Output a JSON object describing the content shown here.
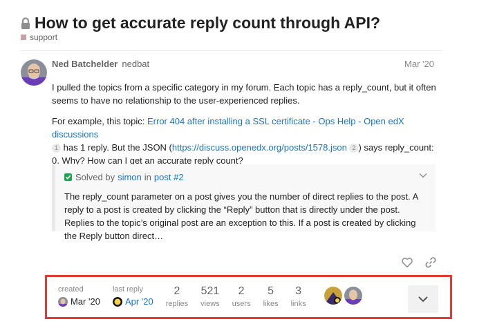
{
  "topic": {
    "title": "How to get accurate reply count through API?",
    "category": "support",
    "category_color": "#c7a1a9"
  },
  "post": {
    "author_name": "Ned Batchelder",
    "author_username": "nedbat",
    "date": "Mar '20",
    "paragraph1": "I pulled the topics from a specific category in my forum. Each topic has a reply_count, but it often seems to have no relationship to the user-experienced replies.",
    "p2_prefix": "For example, this topic: ",
    "p2_link1": "Error 404 after installing a SSL certificate - Ops Help - Open edX discussions",
    "p2_badge1": "1",
    "p2_mid": " has 1 reply. But the JSON (",
    "p2_link2": "https://discuss.openedx.org/posts/1578.json",
    "p2_badge2": "2",
    "p2_suffix": ") says reply_count: 0. Why? How can I get an accurate reply count?"
  },
  "solution": {
    "solved_by_label": "Solved by",
    "solver": "simon",
    "in_label": "in",
    "post_ref": "post #2",
    "excerpt": "The reply_count parameter on a post gives you the number of direct replies to the post. A reply to a post is created by clicking the “Reply” button that is directly under the post. Replies to the topic’s original post are an exception to this. If a post is created by clicking the Reply button direct…",
    "check_color": "#1ca551"
  },
  "actions": {
    "like_icon": "heart-icon",
    "share_icon": "link-icon"
  },
  "summary": {
    "created_label": "created",
    "created_date": "Mar '20",
    "last_reply_label": "last reply",
    "last_reply_date": "Apr '20",
    "replies_count": "2",
    "replies_label": "replies",
    "views_count": "521",
    "views_label": "views",
    "users_count": "2",
    "users_label": "users",
    "likes_count": "5",
    "likes_label": "likes",
    "links_count": "3",
    "links_label": "links",
    "highlight_color": "#e23a2e"
  }
}
